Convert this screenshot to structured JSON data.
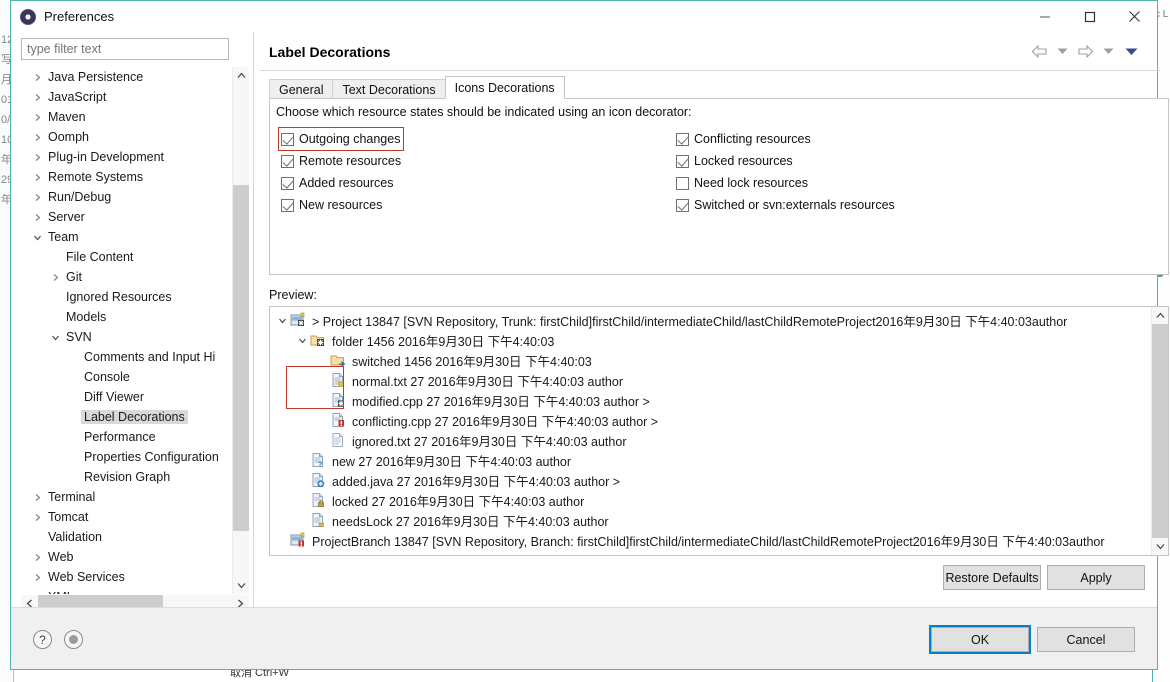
{
  "background": {
    "left_glyphs": "12写月01 0/ 10年29年",
    "right_glyphs": "c L",
    "bottom_text": "取消 Ctrl+W"
  },
  "window": {
    "title": "Preferences",
    "icon": "preferences-gear-icon",
    "minimize_label": "Minimize",
    "maximize_label": "Maximize",
    "close_label": "Close"
  },
  "sidebar": {
    "filter_placeholder": "type filter text",
    "filter_value": "",
    "selected": "Label Decorations",
    "items": [
      {
        "label": "Java Persistence",
        "indent": 0,
        "state": "collapsed"
      },
      {
        "label": "JavaScript",
        "indent": 0,
        "state": "collapsed"
      },
      {
        "label": "Maven",
        "indent": 0,
        "state": "collapsed"
      },
      {
        "label": "Oomph",
        "indent": 0,
        "state": "collapsed"
      },
      {
        "label": "Plug-in Development",
        "indent": 0,
        "state": "collapsed"
      },
      {
        "label": "Remote Systems",
        "indent": 0,
        "state": "collapsed"
      },
      {
        "label": "Run/Debug",
        "indent": 0,
        "state": "collapsed"
      },
      {
        "label": "Server",
        "indent": 0,
        "state": "collapsed"
      },
      {
        "label": "Team",
        "indent": 0,
        "state": "expanded"
      },
      {
        "label": "File Content",
        "indent": 1,
        "state": "leaf"
      },
      {
        "label": "Git",
        "indent": 1,
        "state": "collapsed"
      },
      {
        "label": "Ignored Resources",
        "indent": 1,
        "state": "leaf"
      },
      {
        "label": "Models",
        "indent": 1,
        "state": "leaf"
      },
      {
        "label": "SVN",
        "indent": 1,
        "state": "expanded"
      },
      {
        "label": "Comments and Input Hi",
        "indent": 2,
        "state": "leaf"
      },
      {
        "label": "Console",
        "indent": 2,
        "state": "leaf"
      },
      {
        "label": "Diff Viewer",
        "indent": 2,
        "state": "leaf"
      },
      {
        "label": "Label Decorations",
        "indent": 2,
        "state": "leaf",
        "selected": true
      },
      {
        "label": "Performance",
        "indent": 2,
        "state": "leaf"
      },
      {
        "label": "Properties Configuration",
        "indent": 2,
        "state": "leaf"
      },
      {
        "label": "Revision Graph",
        "indent": 2,
        "state": "leaf"
      },
      {
        "label": "Terminal",
        "indent": 0,
        "state": "collapsed"
      },
      {
        "label": "Tomcat",
        "indent": 0,
        "state": "collapsed"
      },
      {
        "label": "Validation",
        "indent": 0,
        "state": "leaf"
      },
      {
        "label": "Web",
        "indent": 0,
        "state": "collapsed"
      },
      {
        "label": "Web Services",
        "indent": 0,
        "state": "collapsed"
      },
      {
        "label": "XML",
        "indent": 0,
        "state": "collapsed"
      }
    ]
  },
  "page": {
    "title": "Label Decorations",
    "nav": {
      "back_icon": "arrow-left-icon",
      "back_menu_icon": "chevron-down-icon",
      "forward_icon": "arrow-right-icon",
      "forward_menu_icon": "chevron-down-icon",
      "menu_icon": "chevron-down-filled-icon"
    },
    "tabs": [
      {
        "label": "General",
        "active": false
      },
      {
        "label": "Text Decorations",
        "active": false
      },
      {
        "label": "Icons Decorations",
        "active": true
      }
    ],
    "prompt": "Choose which resource states should be indicated using an icon decorator:",
    "checkboxes_left": [
      {
        "label": "Outgoing changes",
        "checked": true,
        "highlighted": true
      },
      {
        "label": "Remote resources",
        "checked": true,
        "highlighted": false
      },
      {
        "label": "Added resources",
        "checked": true,
        "highlighted": false
      },
      {
        "label": "New resources",
        "checked": true,
        "highlighted": false
      }
    ],
    "checkboxes_right": [
      {
        "label": "Conflicting resources",
        "checked": true,
        "highlighted": false
      },
      {
        "label": "Locked resources",
        "checked": true,
        "highlighted": false
      },
      {
        "label": "Need lock resources",
        "checked": false,
        "highlighted": false
      },
      {
        "label": "Switched or svn:externals resources",
        "checked": true,
        "highlighted": false
      }
    ],
    "preview_label": "Preview:",
    "preview_rows": [
      {
        "indent": 0,
        "twisty": "expanded",
        "icon": "project-repo-icon",
        "text": "> Project 13847 [SVN Repository, Trunk: firstChild]firstChild/intermediateChild/lastChildRemoteProject2016年9月30日 下午4:40:03author"
      },
      {
        "indent": 1,
        "twisty": "expanded",
        "icon": "folder-outgoing-icon",
        "text": "folder  1456  2016年9月30日 下午4:40:03"
      },
      {
        "indent": 2,
        "twisty": "none",
        "icon": "folder-switched-icon",
        "text": "switched  1456  2016年9月30日 下午4:40:03"
      },
      {
        "indent": 2,
        "twisty": "none",
        "icon": "file-normal-icon",
        "text": "normal.txt 27 2016年9月30日 下午4:40:03 author"
      },
      {
        "indent": 2,
        "twisty": "none",
        "icon": "file-modified-icon",
        "text": "modified.cpp 27 2016年9月30日 下午4:40:03 author >"
      },
      {
        "indent": 2,
        "twisty": "none",
        "icon": "file-conflicting-icon",
        "text": "conflicting.cpp 27 2016年9月30日 下午4:40:03 author >"
      },
      {
        "indent": 2,
        "twisty": "none",
        "icon": "file-ignored-icon",
        "text": "ignored.txt 27 2016年9月30日 下午4:40:03 author"
      },
      {
        "indent": 1,
        "twisty": "none",
        "icon": "file-new-icon",
        "text": "new 27 2016年9月30日 下午4:40:03 author"
      },
      {
        "indent": 1,
        "twisty": "none",
        "icon": "file-added-icon",
        "text": "added.java 27 2016年9月30日 下午4:40:03 author >"
      },
      {
        "indent": 1,
        "twisty": "none",
        "icon": "file-locked-icon",
        "text": "locked 27 2016年9月30日 下午4:40:03 author"
      },
      {
        "indent": 1,
        "twisty": "none",
        "icon": "file-needslock-icon",
        "text": "needsLock 27 2016年9月30日 下午4:40:03 author"
      },
      {
        "indent": 0,
        "twisty": "none",
        "icon": "project-branch-icon",
        "text": "ProjectBranch 13847 [SVN Repository, Branch: firstChild]firstChild/intermediateChild/lastChildRemoteProject2016年9月30日 下午4:40:03author"
      }
    ],
    "restore_defaults_label": "Restore Defaults",
    "apply_label": "Apply"
  },
  "footer": {
    "help_icon": "question-mark-icon",
    "info_icon": "circle-filled-icon",
    "ok_label": "OK",
    "cancel_label": "Cancel"
  },
  "colors": {
    "accent": "#0a7ec2",
    "highlight_red": "#c0392b",
    "selection_gray": "#d9d9d9",
    "window_border": "#4fb3ae"
  }
}
